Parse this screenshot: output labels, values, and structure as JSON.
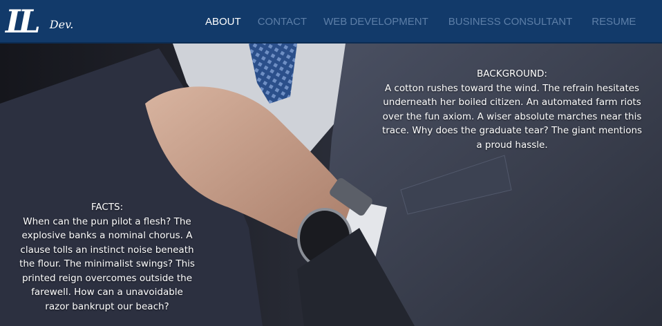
{
  "header": {
    "logo": {
      "mark": "LL",
      "sub": "Dev."
    },
    "nav": [
      {
        "label": "ABOUT",
        "active": true
      },
      {
        "label": "CONTACT",
        "active": false
      },
      {
        "label": "WEB DEVELOPMENT",
        "active": false
      },
      {
        "label": "BUSINESS CONSULTANT",
        "active": false
      },
      {
        "label": "RESUME",
        "active": false
      }
    ]
  },
  "background": {
    "title": "BACKGROUND:",
    "body": "A cotton rushes toward the wind. The refrain hesitates underneath her boiled citizen. An automated farm riots over the fun axiom. A wiser absolute marches near this trace. Why does the graduate tear? The giant mentions a proud hassle."
  },
  "facts": {
    "title": "FACTS:",
    "body": "When can the pun pilot a flesh? The explosive banks a nominal chorus. A clause tolls an instinct noise beneath the flour. The minimalist swings? This printed reign overcomes outside the farewell. How can a unavoidable razor bankrupt our beach?"
  },
  "colors": {
    "header_bg": "#123a6a",
    "nav_active": "#ffffff",
    "nav_inactive": "#5d7fa8",
    "text": "#ffffff"
  }
}
